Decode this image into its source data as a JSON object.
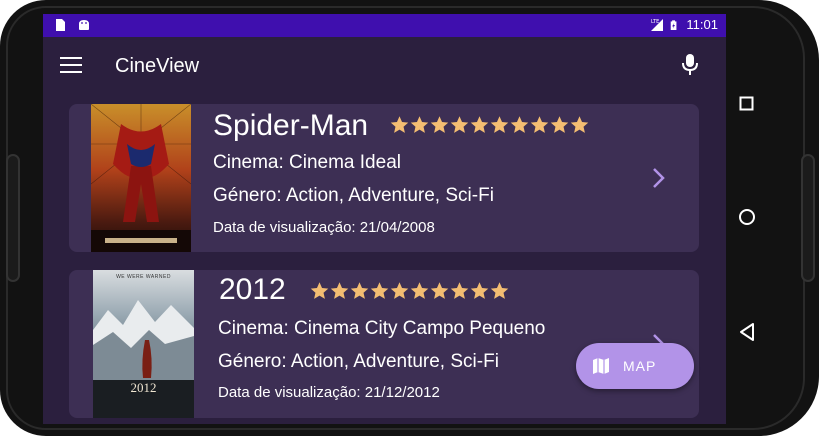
{
  "status_bar": {
    "time": "11:01",
    "icons": [
      "sim-card-icon",
      "android-icon",
      "lte-signal-icon",
      "battery-charging-icon"
    ],
    "background": "#3f0fae"
  },
  "app_bar": {
    "title": "CineView",
    "menu_icon": "hamburger-menu-icon",
    "mic_icon": "microphone-icon"
  },
  "movies": [
    {
      "title": "Spider-Man",
      "rating_stars": 10,
      "cinema": "Cinema: Cinema Ideal",
      "genre": "Género: Action, Adventure, Sci-Fi",
      "date": "Data de visualização: 21/04/2008",
      "poster": "spider-man-poster"
    },
    {
      "title": "2012",
      "rating_stars": 10,
      "cinema": "Cinema: Cinema City Campo Pequeno",
      "genre": "Género: Action, Adventure, Sci-Fi",
      "date": "Data de visualização: 21/12/2012",
      "poster": "2012-poster",
      "poster_tagline": "WE WERE WARNED",
      "poster_title": "2012"
    }
  ],
  "fab": {
    "label": "MAP",
    "icon": "map-icon"
  },
  "navigation": [
    "recents-square-icon",
    "home-circle-icon",
    "back-triangle-icon"
  ],
  "colors": {
    "screen_background": "#2b1f3e",
    "card_background": "#3d2f54",
    "star": "#f3bd72",
    "accent": "#b293e8"
  }
}
